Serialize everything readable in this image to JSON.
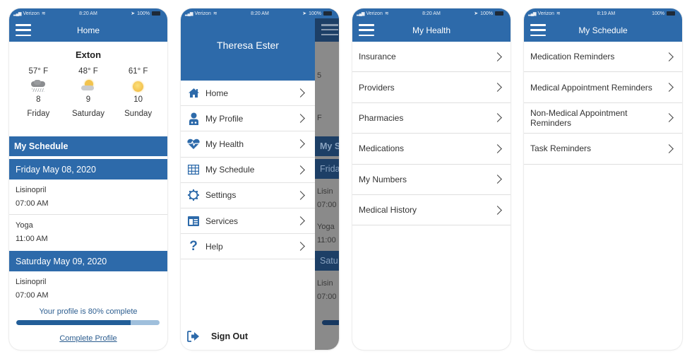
{
  "colors": {
    "primary": "#2d6aaa",
    "link": "#2c5d8f",
    "progress_fill": "#225e98",
    "progress_track": "#9fbfdc"
  },
  "screens": {
    "home": {
      "status": {
        "carrier": "Verizon",
        "time": "8:20 AM",
        "battery": "100%"
      },
      "title": "Home",
      "weather": {
        "city": "Exton",
        "days": [
          {
            "temp": "57° F",
            "icon": "cloud-rain-icon",
            "date": "8",
            "day": "Friday"
          },
          {
            "temp": "48° F",
            "icon": "sun-cloud-icon",
            "date": "9",
            "day": "Saturday"
          },
          {
            "temp": "61° F",
            "icon": "sun-icon",
            "date": "10",
            "day": "Sunday"
          }
        ]
      },
      "schedule": {
        "header": "My Schedule",
        "groups": [
          {
            "date": "Friday May 08, 2020",
            "entries": [
              {
                "name": "Lisinopril",
                "time": "07:00 AM"
              },
              {
                "name": "Yoga",
                "time": "11:00 AM"
              }
            ]
          },
          {
            "date": "Saturday May 09, 2020",
            "entries": [
              {
                "name": "Lisinopril",
                "time": "07:00 AM"
              }
            ]
          }
        ]
      },
      "profile": {
        "message": "Your profile is 80% complete",
        "percent": 80,
        "link": "Complete Profile"
      }
    },
    "menu": {
      "status": {
        "carrier": "Verizon",
        "time": "8:20 AM",
        "battery": "100%"
      },
      "user_name": "Theresa Ester",
      "items": [
        {
          "label": "Home",
          "icon": "home-icon"
        },
        {
          "label": "My Profile",
          "icon": "doctor-icon"
        },
        {
          "label": "My Health",
          "icon": "heart-pulse-icon"
        },
        {
          "label": "My Schedule",
          "icon": "calendar-grid-icon"
        },
        {
          "label": "Settings",
          "icon": "gear-icon"
        },
        {
          "label": "Services",
          "icon": "services-icon"
        },
        {
          "label": "Help",
          "icon": "question-icon"
        }
      ],
      "sign_out": "Sign Out",
      "background_peek": {
        "my_schedule": "My S",
        "friday": "Frida",
        "lisinopril": "Lisin",
        "time1": "07:00",
        "yoga": "Yoga",
        "time2": "11:00",
        "saturday": "Satu",
        "lisinopril2": "Lisin",
        "time3": "07:00",
        "temp": "5",
        "day": "F"
      }
    },
    "my_health": {
      "status": {
        "carrier": "Verizon",
        "time": "8:20 AM",
        "battery": "100%"
      },
      "title": "My Health",
      "items": [
        "Insurance",
        "Providers",
        "Pharmacies",
        "Medications",
        "My Numbers",
        "Medical History"
      ]
    },
    "my_schedule": {
      "status": {
        "carrier": "Verizon",
        "time": "8:19 AM",
        "battery": "100%"
      },
      "title": "My Schedule",
      "items": [
        "Medication Reminders",
        "Medical Appointment Reminders",
        "Non-Medical Appointment Reminders",
        "Task Reminders"
      ]
    }
  }
}
